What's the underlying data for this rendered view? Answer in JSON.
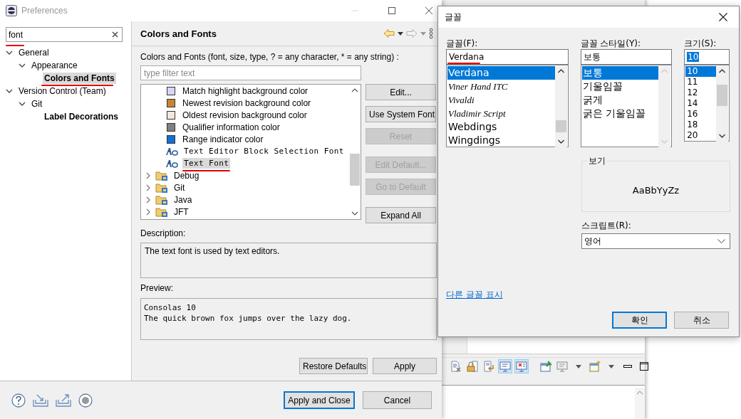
{
  "preferences": {
    "title": "Preferences",
    "search": {
      "value": "font",
      "underlined": true
    },
    "tree": [
      {
        "label": "General",
        "expanded": true,
        "match": false,
        "selected": false,
        "children": [
          {
            "label": "Appearance",
            "expanded": true,
            "match": false,
            "selected": false,
            "children": [
              {
                "label": "Colors and Fonts",
                "match": true,
                "selected": true,
                "underlined": true
              }
            ]
          }
        ]
      },
      {
        "label": "Version Control (Team)",
        "expanded": true,
        "match": false,
        "selected": false,
        "children": [
          {
            "label": "Git",
            "expanded": true,
            "match": false,
            "selected": false,
            "children": [
              {
                "label": "Label Decorations",
                "match": true,
                "selected": false
              }
            ]
          }
        ]
      }
    ],
    "page": {
      "title": "Colors and Fonts",
      "filter_label": "Colors and Fonts (font, size, type, ? = any character, * = any string) :",
      "filter_placeholder": "type filter text",
      "items": [
        {
          "kind": "color",
          "label": "Match highlight background color",
          "color": "#d8d4f4",
          "selected": false
        },
        {
          "kind": "color",
          "label": "Newest revision background color",
          "color": "#c98432",
          "selected": false
        },
        {
          "kind": "color",
          "label": "Oldest revision background color",
          "color": "#f4e8dc",
          "selected": false
        },
        {
          "kind": "color",
          "label": "Qualifier information color",
          "color": "#808080",
          "selected": false
        },
        {
          "kind": "color",
          "label": "Range indicator color",
          "color": "#1070d8",
          "selected": false
        },
        {
          "kind": "font",
          "label": "Text Editor Block Selection Font",
          "selected": false
        },
        {
          "kind": "font",
          "label": "Text Font",
          "selected": true,
          "underlined": true
        },
        {
          "kind": "category",
          "label": "Debug",
          "selected": false
        },
        {
          "kind": "category",
          "label": "Git",
          "selected": false
        },
        {
          "kind": "category",
          "label": "Java",
          "selected": false
        },
        {
          "kind": "category",
          "label": "JFT",
          "selected": false
        }
      ],
      "side_buttons": [
        {
          "label": "Edit...",
          "disabled": false
        },
        {
          "label": "Use System Font",
          "disabled": false
        },
        {
          "label": "Reset",
          "disabled": true
        },
        {
          "label": "Edit Default...",
          "disabled": true
        },
        {
          "label": "Go to Default",
          "disabled": true
        },
        {
          "label": "Expand All",
          "disabled": false
        }
      ],
      "description_heading": "Description:",
      "description": "The text font is used by text editors.",
      "preview_heading": "Preview:",
      "preview": [
        "Consolas 10",
        "The quick brown fox jumps over the lazy dog."
      ],
      "page_buttons": [
        "Restore Defaults",
        "Apply"
      ]
    },
    "buttons": [
      {
        "label": "Apply and Close",
        "default": true
      },
      {
        "label": "Cancel",
        "default": false
      }
    ]
  },
  "font_dialog": {
    "title": "글꼴",
    "font": {
      "label": "글꼴(F):",
      "value": "Verdana",
      "underlined": true,
      "options": [
        {
          "label": "Verdana",
          "kind": "plain",
          "selected": true
        },
        {
          "label": "Viner Hand ITC",
          "kind": "script",
          "selected": false
        },
        {
          "label": "Vivaldi",
          "kind": "script",
          "selected": false
        },
        {
          "label": "Vladimir Script",
          "kind": "script",
          "selected": false
        },
        {
          "label": "Webdings",
          "kind": "plain",
          "selected": false
        },
        {
          "label": "Wingdings",
          "kind": "plain",
          "selected": false
        }
      ]
    },
    "style": {
      "label": "글꼴 스타일(Y):",
      "value": "보통",
      "options": [
        {
          "label": "보통",
          "selected": true
        },
        {
          "label": "기울임꼴",
          "selected": false
        },
        {
          "label": "굵게",
          "selected": false
        },
        {
          "label": "굵은 기울임꼴",
          "selected": false
        }
      ]
    },
    "size": {
      "label": "크기(S):",
      "value": "10",
      "options": [
        {
          "label": "10",
          "selected": true
        },
        {
          "label": "11",
          "selected": false
        },
        {
          "label": "12",
          "selected": false
        },
        {
          "label": "14",
          "selected": false
        },
        {
          "label": "16",
          "selected": false
        },
        {
          "label": "18",
          "selected": false
        },
        {
          "label": "20",
          "selected": false
        }
      ]
    },
    "sample": {
      "label": "보기",
      "text": "AaBbYyZz"
    },
    "script": {
      "label": "스크립트(R):",
      "value": "영어"
    },
    "link": "다른 글꼴 표시",
    "buttons": [
      {
        "label": "확인",
        "default": true
      },
      {
        "label": "취소",
        "default": false
      }
    ]
  },
  "ide": {
    "toolbar": [
      {
        "kind": "clear"
      },
      {
        "kind": "lock"
      },
      {
        "kind": "wrap"
      },
      {
        "kind": "console",
        "pressed": true
      },
      {
        "kind": "console-error",
        "pressed": true
      },
      {
        "kind": "separator"
      },
      {
        "kind": "pin"
      },
      {
        "kind": "display"
      },
      {
        "kind": "dropdown"
      },
      {
        "kind": "new-window"
      },
      {
        "kind": "dropdown"
      },
      {
        "kind": "minimize"
      },
      {
        "kind": "maximize"
      }
    ]
  }
}
